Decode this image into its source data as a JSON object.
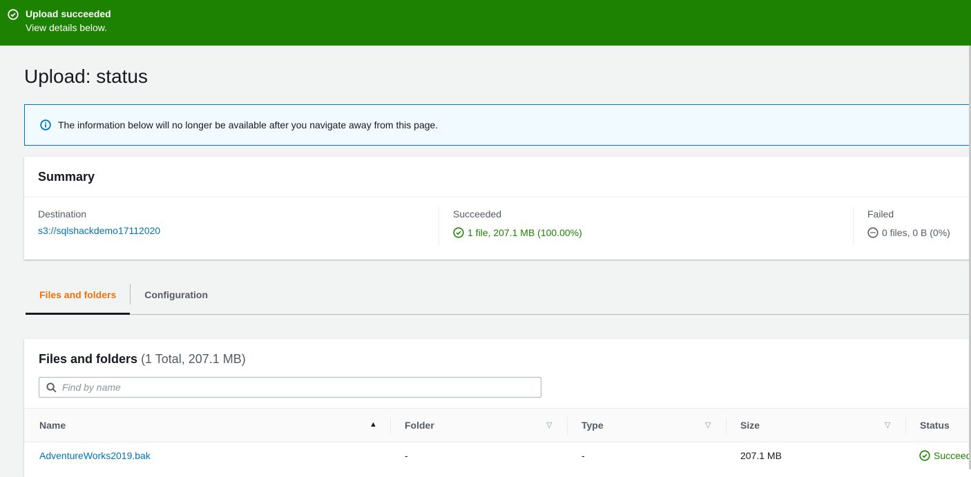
{
  "flash": {
    "title": "Upload succeeded",
    "detail": "View details below."
  },
  "page_title": "Upload: status",
  "info": "The information below will no longer be available after you navigate away from this page.",
  "summary": {
    "title": "Summary",
    "destination": {
      "label": "Destination",
      "value": "s3://sqlshackdemo17112020"
    },
    "succeeded": {
      "label": "Succeeded",
      "value": "1 file, 207.1 MB (100.00%)"
    },
    "failed": {
      "label": "Failed",
      "value": "0 files, 0 B (0%)"
    }
  },
  "tabs": [
    "Files and folders",
    "Configuration"
  ],
  "files": {
    "title": "Files and folders",
    "count": "(1 Total, 207.1 MB)",
    "search_placeholder": "Find by name",
    "columns": [
      "Name",
      "Folder",
      "Type",
      "Size",
      "Status"
    ],
    "rows": [
      {
        "name": "AdventureWorks2019.bak",
        "folder": "-",
        "type": "-",
        "size": "207.1 MB",
        "status": "Succeed"
      }
    ]
  },
  "colors": {
    "success": "#1d8102",
    "accent": "#ec7211",
    "link": "#0073bb"
  }
}
